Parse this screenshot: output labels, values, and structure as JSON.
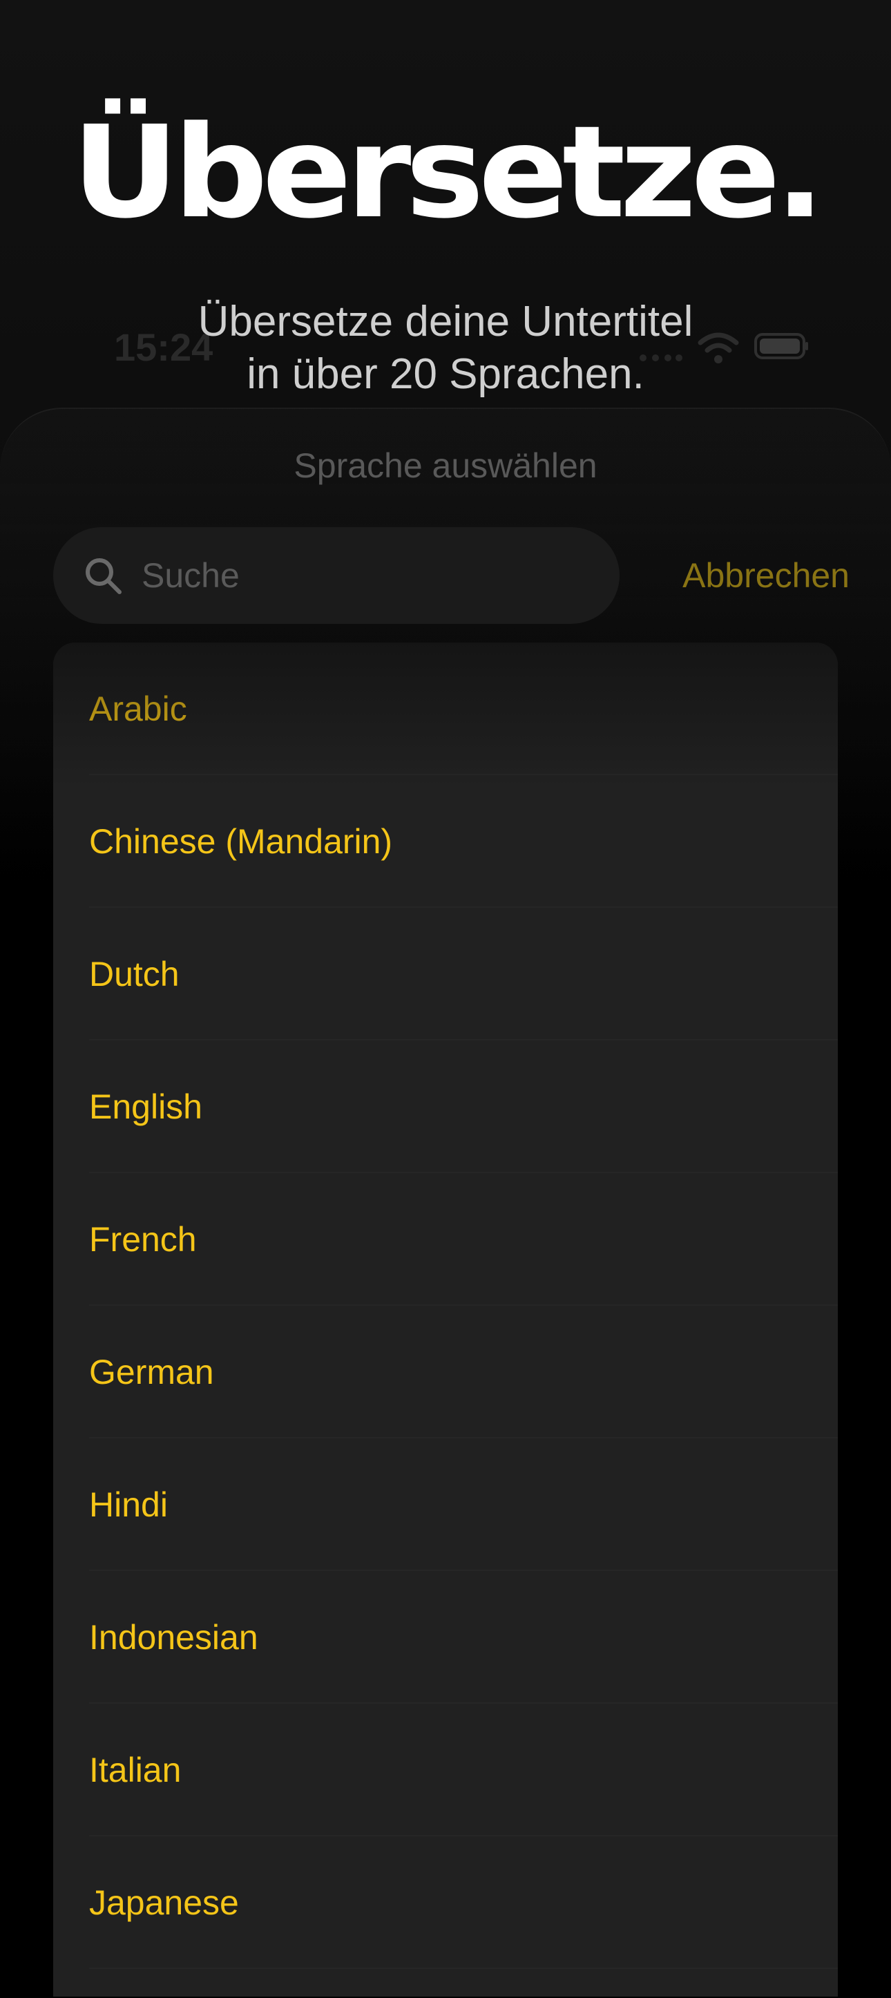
{
  "hero": {
    "headline": "Übersetze.",
    "subline_1": "Übersetze deine Untertitel",
    "subline_2": "in über 20 Sprachen."
  },
  "status_bar": {
    "time": "15:24"
  },
  "sheet": {
    "title": "Sprache auswählen",
    "search_placeholder": "Suche",
    "search_value": "",
    "cancel_label": "Abbrechen"
  },
  "languages": [
    "Arabic",
    "Chinese (Mandarin)",
    "Dutch",
    "English",
    "French",
    "German",
    "Hindi",
    "Indonesian",
    "Italian",
    "Japanese"
  ],
  "colors": {
    "accent": "#f5c518",
    "background": "#000000",
    "list_background": "#212121"
  },
  "icons": {
    "search": "magnifier-icon",
    "wifi": "wifi-icon",
    "battery": "battery-icon",
    "signal": "signal-dots-icon"
  }
}
